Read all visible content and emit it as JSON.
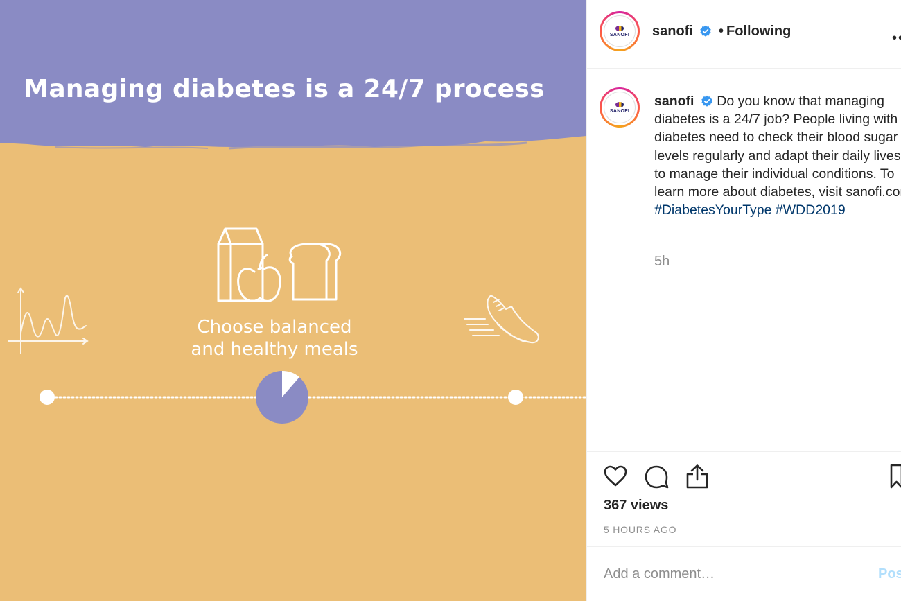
{
  "media": {
    "headline": "Managing diabetes is a 24/7 process",
    "caption_line1": "Choose balanced",
    "caption_line2": "and healthy meals",
    "colors": {
      "band": "#8a8bc4",
      "background": "#ebbe76",
      "accent": "#8a8bc4"
    },
    "icons": [
      "glucose-graph-icon",
      "food-icon",
      "sneaker-icon",
      "pie-timer-icon"
    ]
  },
  "header": {
    "avatar_text": "SANOFI",
    "username": "sanofi",
    "separator": "•",
    "follow_status": "Following",
    "more": "•••"
  },
  "post": {
    "username": "sanofi",
    "caption": "Do you know that managing diabetes is a 24/7 job? People living with diabetes need to check their blood sugar levels regularly and adapt their daily lives, to manage their individual conditions. To learn more about diabetes, visit sanofi.com",
    "hashtags": [
      "#DiabetesYourType",
      "#WDD2019"
    ],
    "time_ago": "5h"
  },
  "engagement": {
    "views": "367 views",
    "timestamp": "5 HOURS AGO"
  },
  "comment": {
    "placeholder": "Add a comment…",
    "post_label": "Post"
  }
}
